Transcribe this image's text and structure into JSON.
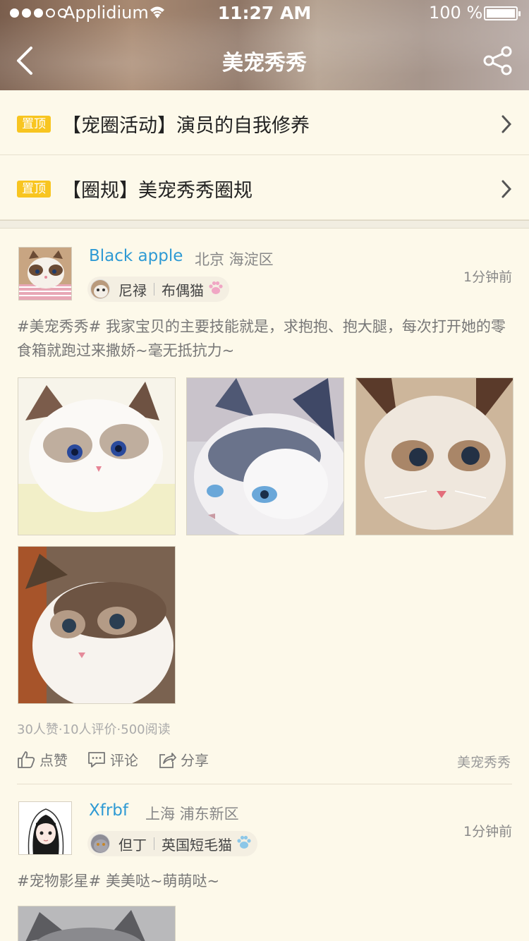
{
  "status_bar": {
    "carrier": "Applidium",
    "time": "11:27 AM",
    "battery": "100 %"
  },
  "nav": {
    "title": "美宠秀秀"
  },
  "pinned": [
    {
      "badge": "置顶",
      "text": "【宠圈活动】演员的自我修养"
    },
    {
      "badge": "置顶",
      "text": "【圈规】美宠秀秀圈规"
    }
  ],
  "posts": [
    {
      "username": "Black apple",
      "location": "北京 海淀区",
      "time": "1分钟前",
      "pet_name": "尼禄",
      "pet_breed": "布偶猫",
      "paw_color": "#f0a6c4",
      "content": "#美宠秀秀# 我家宝贝的主要技能就是，求抱抱、抱大腿，每次打开她的零食箱就跑过来撒娇~毫无抵抗力~",
      "stats": "30人赞·10人评价·500阅读",
      "actions": {
        "like": "点赞",
        "comment": "评论",
        "share": "分享"
      },
      "circle": "美宠秀秀"
    },
    {
      "username": "Xfrbf",
      "location": "上海 浦东新区",
      "time": "1分钟前",
      "pet_name": "但丁",
      "pet_breed": "英国短毛猫",
      "paw_color": "#8cc7e8",
      "content": "#宠物影星# 美美哒~萌萌哒~"
    }
  ],
  "colors": {
    "accent_blue": "#2e9ad4",
    "pin_badge": "#f8c520",
    "page_bg": "#fdf9ea"
  }
}
